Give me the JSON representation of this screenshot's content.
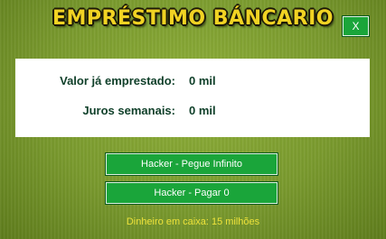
{
  "window": {
    "title": "EMPRÉSTIMO BÁNCARIO",
    "close_label": "X"
  },
  "info": {
    "borrowed_label": "Valor já emprestado:",
    "borrowed_value": "0 mil",
    "interest_label": "Juros semanais:",
    "interest_value": "0 mil"
  },
  "actions": {
    "infinite_label": "Hacker - Pegue Infinito",
    "pay_zero_label": "Hacker - Pagar 0"
  },
  "footer": {
    "cash_text": "Dinheiro em caixa: 15 milhões"
  },
  "colors": {
    "background": "#7a9a2e",
    "title": "#f1d323",
    "button": "#1aa53a",
    "panel": "#ffffff",
    "label_text": "#10402a",
    "footer_text": "#ede23a"
  }
}
